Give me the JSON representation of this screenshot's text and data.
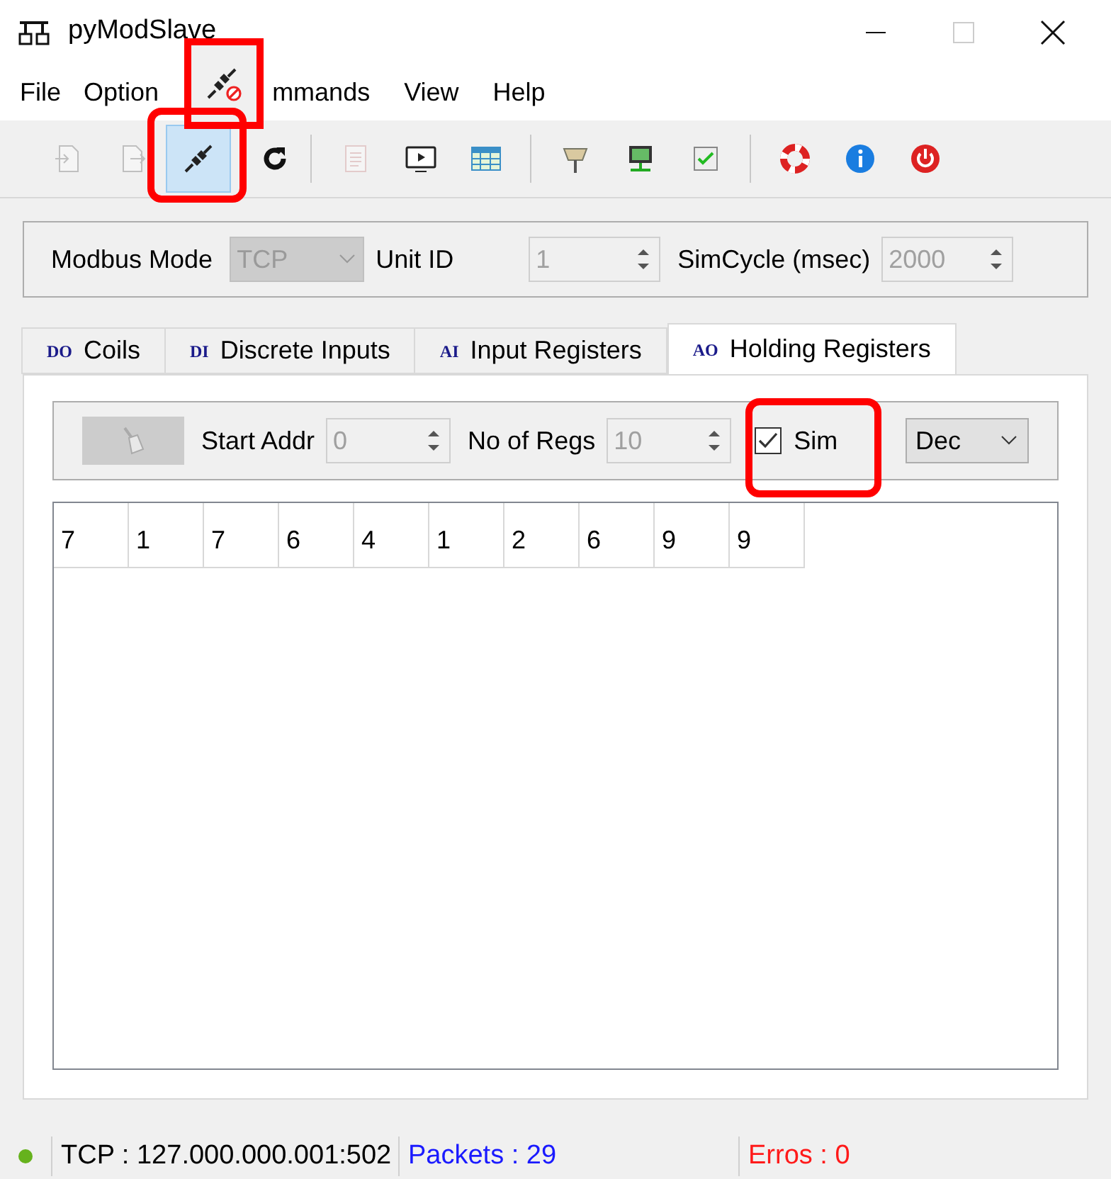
{
  "window": {
    "title": "pyModSlave"
  },
  "menu": [
    {
      "label": "File"
    },
    {
      "label": "Option"
    },
    {
      "label": "mmands"
    },
    {
      "label": "View"
    },
    {
      "label": "Help"
    }
  ],
  "toolbar": [
    {
      "kind": "load",
      "disabled": true,
      "selected": false
    },
    {
      "kind": "save",
      "disabled": true,
      "selected": false
    },
    {
      "kind": "connect",
      "disabled": false,
      "selected": true
    },
    {
      "kind": "reset",
      "disabled": false,
      "selected": false
    },
    {
      "kind": "sep"
    },
    {
      "kind": "log",
      "disabled": true,
      "selected": false
    },
    {
      "kind": "monitor",
      "disabled": false,
      "selected": false
    },
    {
      "kind": "table",
      "disabled": false,
      "selected": false
    },
    {
      "kind": "sep"
    },
    {
      "kind": "serial",
      "disabled": false,
      "selected": false
    },
    {
      "kind": "network",
      "disabled": false,
      "selected": false
    },
    {
      "kind": "check",
      "disabled": false,
      "selected": false
    },
    {
      "kind": "sep"
    },
    {
      "kind": "help",
      "disabled": false,
      "selected": false
    },
    {
      "kind": "info",
      "disabled": false,
      "selected": false
    },
    {
      "kind": "exit",
      "disabled": false,
      "selected": false
    }
  ],
  "settings": {
    "mode_label": "Modbus Mode",
    "mode": "TCP",
    "unit_label": "Unit ID",
    "unit": "1",
    "cycle_label": "SimCycle (msec)",
    "cycle": "2000"
  },
  "tabs": [
    {
      "tag": "DO",
      "label": "Coils",
      "selected": false
    },
    {
      "tag": "DI",
      "label": "Discrete Inputs",
      "selected": false
    },
    {
      "tag": "AI",
      "label": "Input Registers",
      "selected": false
    },
    {
      "tag": "AO",
      "label": "Holding Registers",
      "selected": true
    }
  ],
  "registers": {
    "start_label": "Start Addr",
    "start": "0",
    "count_label": "No of Regs",
    "count": "10",
    "sim_label": "Sim",
    "sim_checked": true,
    "format": "Dec",
    "values": [
      "7",
      "1",
      "7",
      "6",
      "4",
      "1",
      "2",
      "6",
      "9",
      "9"
    ]
  },
  "status_bar": [
    {
      "text": "TCP : 127.000.000.001:502",
      "color": "#000000"
    },
    {
      "text": "Packets : 29",
      "color": "#1a1aff"
    },
    {
      "text": "Erros : 0",
      "color": "#ff1a1a"
    }
  ],
  "status_light": {
    "color": "#66b21d"
  }
}
